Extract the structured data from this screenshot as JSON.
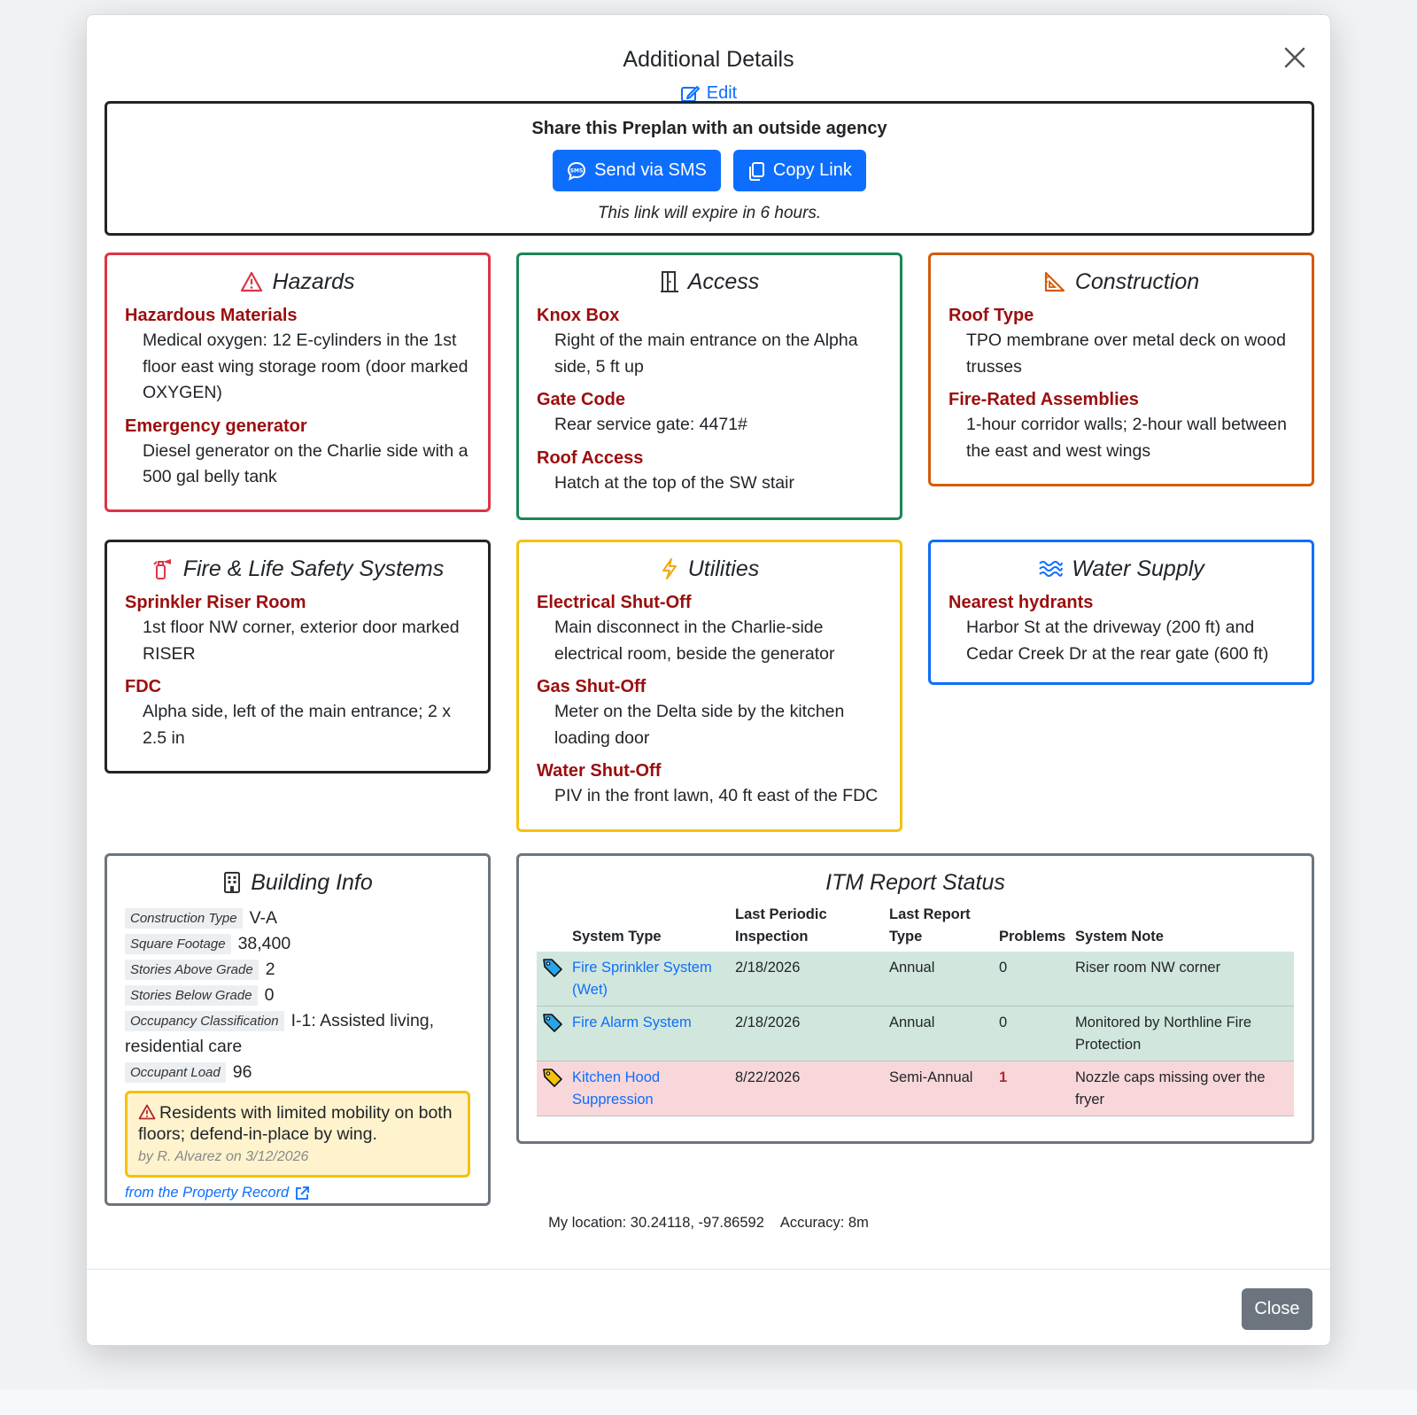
{
  "modal": {
    "title": "Additional Details",
    "edit_label": "Edit",
    "close_label": "Close"
  },
  "share": {
    "title": "Share this Preplan with an outside agency",
    "sms_label": "Send via SMS",
    "copy_label": "Copy Link",
    "note": "This link will expire in 6 hours."
  },
  "hazards": {
    "title": "Hazards",
    "items": [
      {
        "label": "Hazardous Materials",
        "value": "Medical oxygen: 12 E-cylinders in the 1st floor east wing storage room (door marked OXYGEN)"
      },
      {
        "label": "Emergency generator",
        "value": "Diesel generator on the Charlie side with a 500 gal belly tank"
      }
    ]
  },
  "access": {
    "title": "Access",
    "items": [
      {
        "label": "Knox Box",
        "value": "Right of the main entrance on the Alpha side, 5 ft up"
      },
      {
        "label": "Gate Code",
        "value": "Rear service gate: 4471#"
      },
      {
        "label": "Roof Access",
        "value": "Hatch at the top of the SW stair"
      }
    ]
  },
  "construction": {
    "title": "Construction",
    "items": [
      {
        "label": "Roof Type",
        "value": "TPO membrane over metal deck on wood trusses"
      },
      {
        "label": "Fire-Rated Assemblies",
        "value": "1-hour corridor walls; 2-hour wall between the east and west wings"
      }
    ]
  },
  "fire_life": {
    "title": "Fire & Life Safety Systems",
    "items": [
      {
        "label": "Sprinkler Riser Room",
        "value": "1st floor NW corner, exterior door marked RISER"
      },
      {
        "label": "FDC",
        "value": "Alpha side, left of the main entrance; 2 x 2.5 in"
      }
    ]
  },
  "utilities": {
    "title": "Utilities",
    "items": [
      {
        "label": "Electrical Shut-Off",
        "value": "Main disconnect in the Charlie-side electrical room, beside the generator"
      },
      {
        "label": "Gas Shut-Off",
        "value": "Meter on the Delta side by the kitchen loading door"
      },
      {
        "label": "Water Shut-Off",
        "value": "PIV in the front lawn, 40 ft east of the FDC"
      }
    ]
  },
  "water": {
    "title": "Water Supply",
    "items": [
      {
        "label": "Nearest hydrants",
        "value": "Harbor St at the driveway (200 ft) and Cedar Creek Dr at the rear gate (600 ft)"
      }
    ]
  },
  "building": {
    "title": "Building Info",
    "rows": [
      {
        "label": "Construction Type",
        "value": "V-A"
      },
      {
        "label": "Square Footage",
        "value": "38,400"
      },
      {
        "label": "Stories Above Grade",
        "value": "2"
      },
      {
        "label": "Stories Below Grade",
        "value": "0"
      },
      {
        "label": "Occupancy Classification",
        "value": "I-1: Assisted living, residential care"
      },
      {
        "label": "Occupant Load",
        "value": "96"
      }
    ],
    "warning": "Residents with limited mobility on both floors; defend-in-place by wing.",
    "warning_by": "by R. Alvarez on 3/12/2026",
    "source_link": "from the Property Record"
  },
  "itm": {
    "title": "ITM Report Status",
    "headers": [
      "System Type",
      "Last Periodic Inspection",
      "Last Report Type",
      "Problems",
      "System Note"
    ],
    "rows": [
      {
        "system": "Fire Sprinkler System (Wet)",
        "inspection": "2/18/2026",
        "report_type": "Annual",
        "problems": "0",
        "note": "Riser room NW corner",
        "status": "ok"
      },
      {
        "system": "Fire Alarm System",
        "inspection": "2/18/2026",
        "report_type": "Annual",
        "problems": "0",
        "note": "Monitored by Northline Fire Protection",
        "status": "ok"
      },
      {
        "system": "Kitchen Hood Suppression",
        "inspection": "8/22/2026",
        "report_type": "Semi-Annual",
        "problems": "1",
        "note": "Nozzle caps missing over the fryer",
        "status": "bad"
      }
    ]
  },
  "location": {
    "text": "My location: 30.24118, -97.86592",
    "accuracy": "Accuracy: 8m"
  },
  "colors": {
    "hazards": "#dc3545",
    "access": "#198754",
    "construction": "#d35b0e",
    "fire_life": "#212529",
    "utilities": "#f5c10e",
    "water": "#0d6efd",
    "building": "#6c757d",
    "itm": "#6c757d",
    "label_red": "#9b0e0e",
    "primary": "#0d6efd"
  }
}
